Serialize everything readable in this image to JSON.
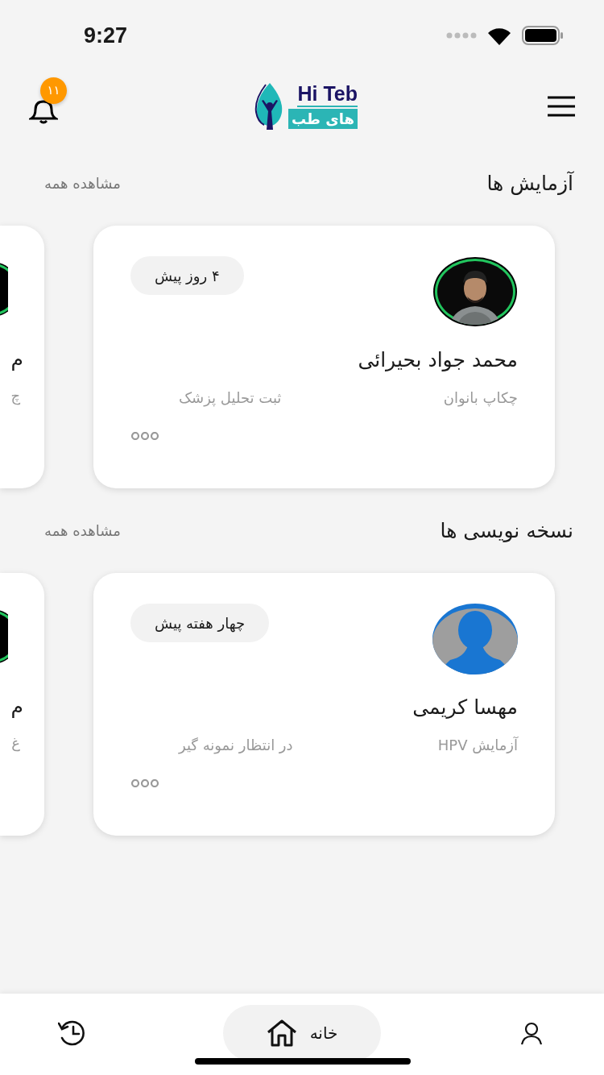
{
  "status_bar": {
    "time": "9:27"
  },
  "header": {
    "notifications": "۱۱",
    "logo": {
      "latin": "Hi Teb",
      "persian": "های طب"
    }
  },
  "sections": [
    {
      "title": "آزمایش ها",
      "see_all": "مشاهده همه",
      "card": {
        "time": "۴ روز پیش",
        "name": "محمد جواد بحیرائی",
        "test": "چکاپ بانوان",
        "status": "ثبت تحلیل پزشک"
      },
      "partial": {
        "name": "م",
        "sub": "چ"
      }
    },
    {
      "title": "نسخه نویسی ها",
      "see_all": "مشاهده همه",
      "card": {
        "kind": "default",
        "time": "چهار هفته پیش",
        "name": "مهسا کریمی",
        "test": "آزمایش HPV",
        "status": "در انتظار نمونه گیر"
      },
      "partial": {
        "name": "م",
        "sub": "غ"
      }
    }
  ],
  "nav": [
    {
      "kind": "user",
      "selected": false
    },
    {
      "kind": "home",
      "label": "خانه",
      "selected": true
    },
    {
      "kind": "history",
      "selected": false
    }
  ]
}
